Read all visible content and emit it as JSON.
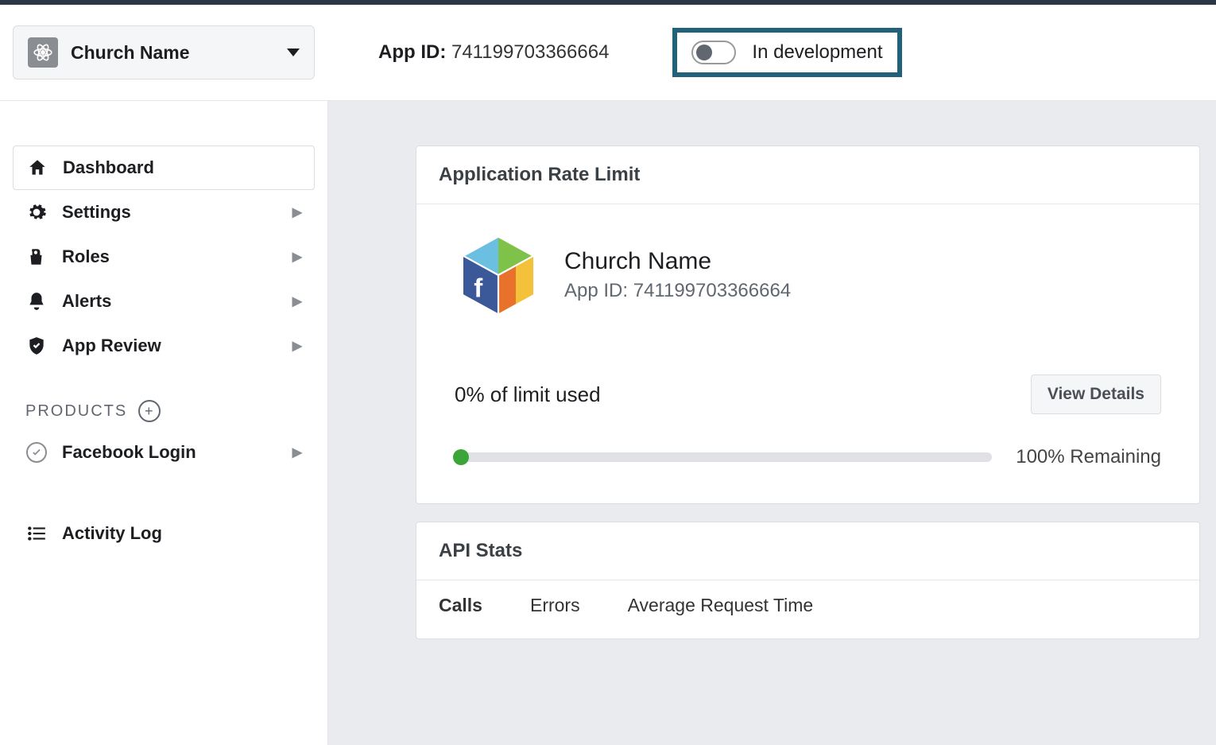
{
  "header": {
    "app_selector_name": "Church Name",
    "app_id_label": "App ID:",
    "app_id_value": "741199703366664",
    "status_text": "In development"
  },
  "sidebar": {
    "items": [
      {
        "label": "Dashboard",
        "icon": "home",
        "expandable": false,
        "active": true
      },
      {
        "label": "Settings",
        "icon": "gear",
        "expandable": true,
        "active": false
      },
      {
        "label": "Roles",
        "icon": "roles",
        "expandable": true,
        "active": false
      },
      {
        "label": "Alerts",
        "icon": "bell",
        "expandable": true,
        "active": false
      },
      {
        "label": "App Review",
        "icon": "shield",
        "expandable": true,
        "active": false
      }
    ],
    "products_header": "PRODUCTS",
    "products": [
      {
        "label": "Facebook Login",
        "icon": "check",
        "expandable": true
      }
    ],
    "activity_log": "Activity Log"
  },
  "main": {
    "rate_limit": {
      "title": "Application Rate Limit",
      "app_name": "Church Name",
      "app_id_label": "App ID:",
      "app_id_value": "741199703366664",
      "limit_used_text": "0% of limit used",
      "view_details": "View Details",
      "remaining_text": "100% Remaining",
      "progress_percent": 0
    },
    "api_stats": {
      "title": "API Stats",
      "tabs": [
        "Calls",
        "Errors",
        "Average Request Time"
      ],
      "active_tab": 0
    }
  }
}
